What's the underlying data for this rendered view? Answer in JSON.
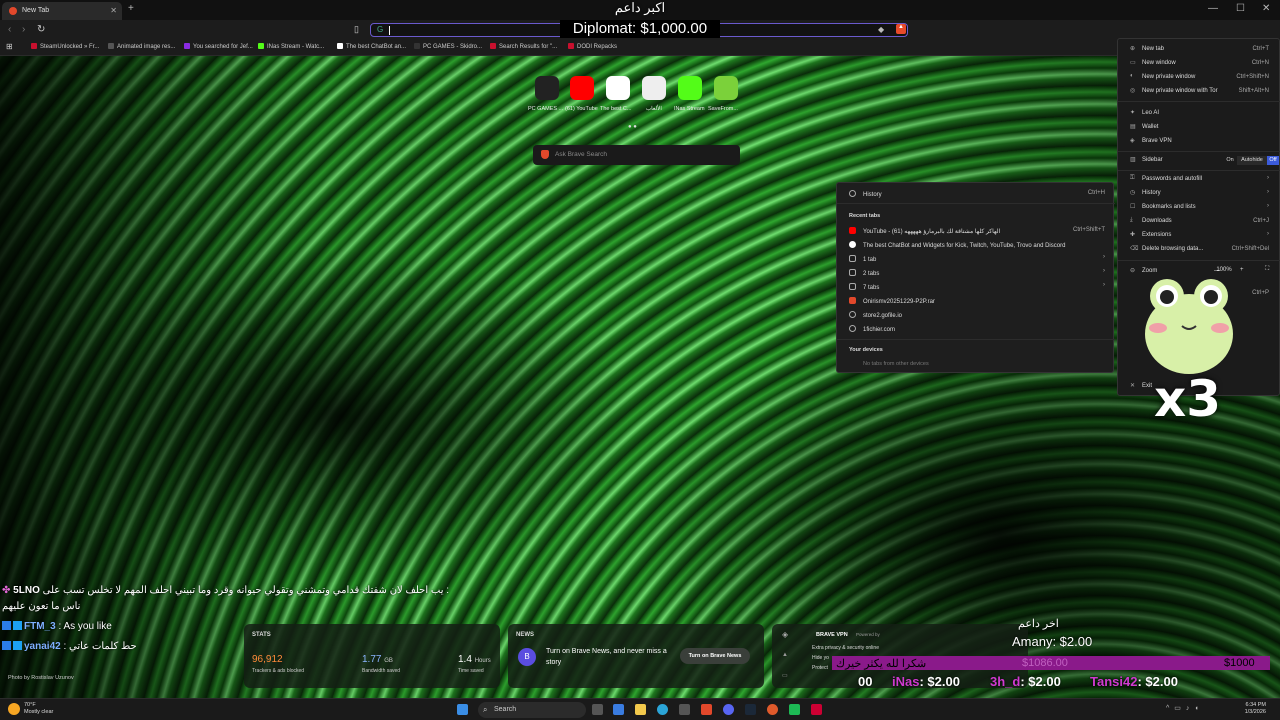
{
  "browser": {
    "tab_title": "New Tab",
    "omni_placeholder": "",
    "bookmarks": [
      {
        "label": "SteamUnlocked » Fr...",
        "color": "#c8102e"
      },
      {
        "label": "Animated image res...",
        "color": "#555555"
      },
      {
        "label": "You searched for Jef...",
        "color": "#8a2be2"
      },
      {
        "label": "INas Stream - Watc...",
        "color": "#53fc18"
      },
      {
        "label": "The best ChatBot an...",
        "color": "#ffffff"
      },
      {
        "label": "PC GAMES - Skidro...",
        "color": "#333333"
      },
      {
        "label": "Search Results for \"...",
        "color": "#c8102e"
      },
      {
        "label": "DODI Repacks",
        "color": "#c8102e"
      }
    ]
  },
  "overlay": {
    "top_title": "اكبر داعم",
    "top_amount": "Diplomat: $1,000.00",
    "frog_multiplier": "x3",
    "donation_title": "اخر داعم",
    "donation_amount": "Amany: $2.00",
    "donation_bar_left": "شكرا لله يكثر خيرك",
    "donation_bar_mid": "$1086.00",
    "donation_bar_right": "$1000",
    "ticker": [
      {
        "name": "00",
        "amount": ""
      },
      {
        "name": "iNas",
        "amount": ": $2.00"
      },
      {
        "name": "3h_d",
        "amount": ": $2.00"
      },
      {
        "name": "Tansi42",
        "amount": ": $2.00"
      }
    ]
  },
  "newtab": {
    "shortcuts": [
      {
        "label": "PC GAMES ...",
        "color": "#222222"
      },
      {
        "label": "(61) YouTube",
        "color": "#ff0000"
      },
      {
        "label": "The best C...",
        "color": "#ffffff"
      },
      {
        "label": "الألعاب",
        "color": "#eeeeee"
      },
      {
        "label": "INas Stream",
        "color": "#53fc18"
      },
      {
        "label": "SaveFrom...",
        "color": "#7bd13a"
      }
    ],
    "search_placeholder": "Ask Brave Search",
    "photo_credit": "Photo by Rostislav Uzunov",
    "stats": {
      "title": "STATS",
      "trackers_value": "96,912",
      "trackers_label": "Trackers & ads blocked",
      "bandwidth_value": "1.77",
      "bandwidth_unit": "GB",
      "bandwidth_label": "Bandwidth saved",
      "time_value": "1.4",
      "time_unit": "Hours",
      "time_label": "Time saved"
    },
    "news": {
      "title": "NEWS",
      "text": "Turn on Brave News, and never miss a story",
      "button": "Turn on Brave News"
    },
    "vpn": {
      "title": "BRAVE VPN",
      "powered": "Powered by",
      "line1": "Extra privacy & security online",
      "line2": "Hide yo",
      "line3": "Protect"
    }
  },
  "history_menu": {
    "history_label": "History",
    "history_shortcut": "Ctrl+H",
    "recent_tabs_header": "Recent tabs",
    "items": [
      {
        "label": "YouTube - الهاكر كلها مشتاقة لك بالبرمارؤ هههههه (61)",
        "shortcut": "Ctrl+Shift+T",
        "color": "#ff0000",
        "arrow": ""
      },
      {
        "label": "The best ChatBot and Widgets for Kick, Twitch, YouTube, Trovo and Discord",
        "shortcut": "",
        "color": "#ffffff",
        "arrow": ""
      },
      {
        "label": "1 tab",
        "shortcut": "",
        "color": "#888888",
        "arrow": "›"
      },
      {
        "label": "2 tabs",
        "shortcut": "",
        "color": "#888888",
        "arrow": "›"
      },
      {
        "label": "7 tabs",
        "shortcut": "",
        "color": "#888888",
        "arrow": "›"
      },
      {
        "label": "Onirismv20251229-P2P.rar",
        "shortcut": "",
        "color": "#e2482b",
        "arrow": ""
      },
      {
        "label": "store2.gofile.io",
        "shortcut": "",
        "color": "#888888",
        "arrow": ""
      },
      {
        "label": "1fichier.com",
        "shortcut": "",
        "color": "#888888",
        "arrow": ""
      }
    ],
    "devices_header": "Your devices",
    "devices_empty": "No tabs from other devices"
  },
  "main_menu": {
    "items": [
      {
        "label": "New tab",
        "shortcut": "Ctrl+T"
      },
      {
        "label": "New window",
        "shortcut": "Ctrl+N"
      },
      {
        "label": "New private window",
        "shortcut": "Ctrl+Shift+N"
      },
      {
        "label": "New private window with Tor",
        "shortcut": "Shift+Alt+N"
      },
      {
        "label": "Leo AI",
        "shortcut": ""
      },
      {
        "label": "Wallet",
        "shortcut": ""
      },
      {
        "label": "Brave VPN",
        "shortcut": ""
      },
      {
        "label": "Sidebar",
        "shortcut": ""
      },
      {
        "label": "Passwords and autofill",
        "shortcut": "›"
      },
      {
        "label": "History",
        "shortcut": "›"
      },
      {
        "label": "Bookmarks and lists",
        "shortcut": "›"
      },
      {
        "label": "Downloads",
        "shortcut": "Ctrl+J"
      },
      {
        "label": "Extensions",
        "shortcut": "›"
      },
      {
        "label": "Delete browsing data...",
        "shortcut": "Ctrl+Shift+Del"
      },
      {
        "label": "Zoom",
        "shortcut": ""
      }
    ],
    "sidebar_options": [
      "On",
      "Autohide",
      "Off"
    ],
    "zoom_value": "100%",
    "exit_label": "Exit",
    "print_shortcut": "Ctrl+P"
  },
  "chat": [
    {
      "user": "5LNO",
      "msg": "يب احلف لان شفتك قدامي وتمشني وتقولي حيوانه وقرد وما تبيني احلف المهم لا تخلس تسب على :"
    },
    {
      "user": "",
      "msg": "ناس ما تعون عليهم"
    },
    {
      "user": "FTM_3",
      "msg": ": As you like"
    },
    {
      "user": "yanai42",
      "msg": ": حط كلمات عاتي"
    }
  ],
  "taskbar": {
    "weather_temp": "70°F",
    "weather_desc": "Mostly clear",
    "search_label": "Search",
    "time": "6:34 PM",
    "date": "1/3/2026"
  }
}
